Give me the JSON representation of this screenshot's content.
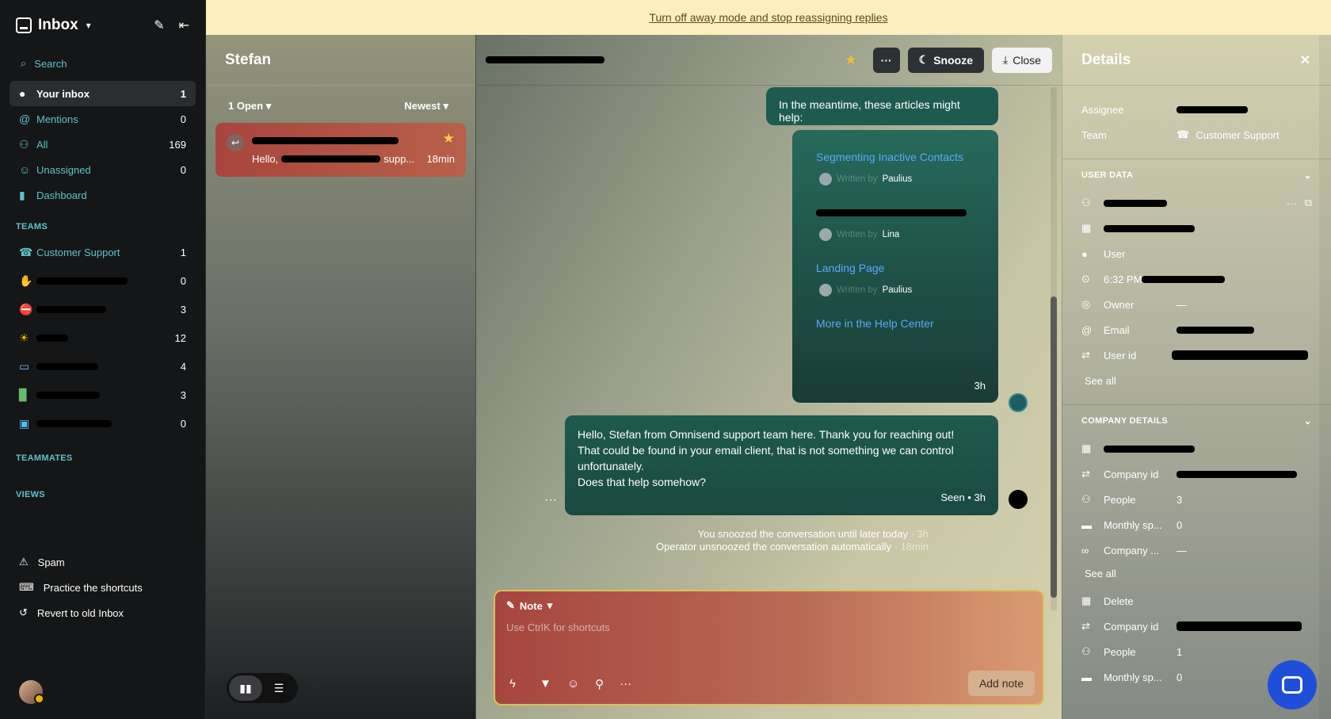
{
  "sidebar": {
    "title": "Inbox",
    "search": "Search",
    "nav": [
      {
        "label": "Your inbox",
        "count": "1"
      },
      {
        "label": "Mentions",
        "count": "0"
      },
      {
        "label": "All",
        "count": "169"
      },
      {
        "label": "Unassigned",
        "count": "0"
      },
      {
        "label": "Dashboard",
        "count": ""
      }
    ],
    "teams_heading": "TEAMS",
    "teams": [
      {
        "label": "Customer Support",
        "count": "1"
      },
      {
        "label": "",
        "count": "0"
      },
      {
        "label": "",
        "count": "3"
      },
      {
        "label": "",
        "count": "12"
      },
      {
        "label": "",
        "count": "4"
      },
      {
        "label": "",
        "count": "3"
      },
      {
        "label": "",
        "count": "0"
      }
    ],
    "teammates_heading": "TEAMMATES",
    "views_heading": "VIEWS",
    "footer": [
      {
        "label": "Spam"
      },
      {
        "label": "Practice the shortcuts"
      },
      {
        "label": "Revert to old Inbox"
      }
    ]
  },
  "banner": {
    "text": "Turn off away mode and stop reassigning replies"
  },
  "conv_list": {
    "title": "Stefan",
    "filter_open": "1 Open",
    "sort": "Newest",
    "items": [
      {
        "preview_prefix": "Hello,",
        "preview_suffix": "supp...",
        "time": "18min"
      }
    ]
  },
  "conversation": {
    "actions": {
      "snooze": "Snooze",
      "close": "Close"
    },
    "msg1": "In the meantime, these articles might help:",
    "articles": [
      {
        "title": "Segmenting Inactive Contacts",
        "by_prefix": "Written by",
        "author": "Paulius"
      },
      {
        "title": "",
        "by_prefix": "Written by",
        "author": "Lina"
      },
      {
        "title": "Landing Page",
        "by_prefix": "Written by",
        "author": "Paulius"
      }
    ],
    "more_link": "More in the Help Center",
    "msg2_time": "3h",
    "msg3": [
      "Hello, Stefan from Omnisend support team here. Thank you for reaching out!",
      "That could be found in your email client, that is not something we can control",
      "unfortunately.",
      "Does that help somehow?"
    ],
    "msg3_status": "Seen • 3h",
    "sys1": "You snoozed the conversation until later today",
    "sys1_time": "· 3h",
    "sys2": "Operator unsnoozed the conversation automatically",
    "sys2_time": "· 18min",
    "composer": {
      "mode": "Note",
      "placeholder": "Use CtrlK for shortcuts",
      "submit": "Add note"
    }
  },
  "details": {
    "title": "Details",
    "assignee_label": "Assignee",
    "team_label": "Team",
    "team_value": "Customer Support",
    "user_data_heading": "USER DATA",
    "user_rows": [
      {
        "label": "",
        "value": ""
      },
      {
        "label": "",
        "value": ""
      },
      {
        "label": "User",
        "value": ""
      },
      {
        "label": "6:32 PM",
        "value": ""
      },
      {
        "label": "Owner",
        "value": "—"
      },
      {
        "label": "Email",
        "value": ""
      },
      {
        "label": "User id",
        "value": ""
      }
    ],
    "see_all": "See all",
    "company_heading": "COMPANY DETAILS",
    "company_rows": [
      {
        "label": "",
        "value": ""
      },
      {
        "label": "Company id",
        "value": ""
      },
      {
        "label": "People",
        "value": "3"
      },
      {
        "label": "Monthly sp...",
        "value": "0"
      },
      {
        "label": "Company ...",
        "value": "—"
      }
    ],
    "company_rows2": [
      {
        "label": "Delete",
        "value": ""
      },
      {
        "label": "Company id",
        "value": ""
      },
      {
        "label": "People",
        "value": "1"
      },
      {
        "label": "Monthly sp...",
        "value": "0"
      }
    ]
  }
}
